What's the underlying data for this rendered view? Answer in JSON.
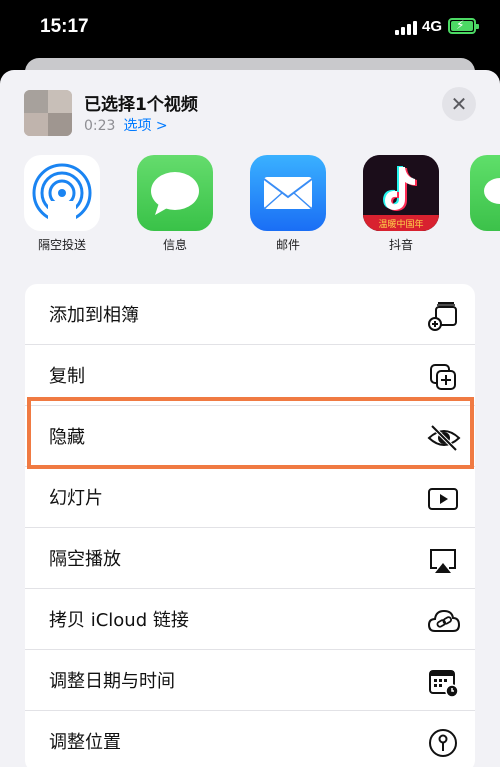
{
  "status_bar": {
    "time": "15:17",
    "network": "4G"
  },
  "share_header": {
    "title": "已选择1个视频",
    "duration": "0:23",
    "options_label": "选项 >",
    "close_icon": "close-icon"
  },
  "apps": [
    {
      "label": "隔空投送",
      "icon": "airdrop-icon"
    },
    {
      "label": "信息",
      "icon": "messages-icon"
    },
    {
      "label": "邮件",
      "icon": "mail-icon"
    },
    {
      "label": "抖音",
      "icon": "douyin-icon",
      "icon_text": "温暖中国年"
    },
    {
      "label": "",
      "icon": "wechat-icon"
    }
  ],
  "actions": [
    {
      "label": "添加到相簿",
      "icon": "add-to-album-icon"
    },
    {
      "label": "复制",
      "icon": "copy-icon"
    },
    {
      "label": "隐藏",
      "icon": "eye-slash-icon",
      "highlighted": true
    },
    {
      "label": "幻灯片",
      "icon": "play-icon"
    },
    {
      "label": "隔空播放",
      "icon": "airplay-icon"
    },
    {
      "label": "拷贝 iCloud 链接",
      "icon": "cloud-link-icon"
    },
    {
      "label": "调整日期与时间",
      "icon": "calendar-icon"
    },
    {
      "label": "调整位置",
      "icon": "location-pin-icon"
    }
  ],
  "colors": {
    "highlight": "#f07a42",
    "accent": "#007aff"
  }
}
